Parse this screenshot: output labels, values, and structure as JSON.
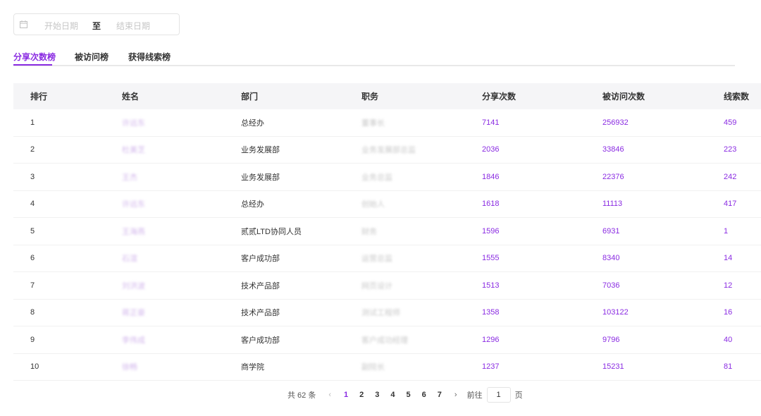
{
  "date_range": {
    "start_placeholder": "开始日期",
    "separator": "至",
    "end_placeholder": "结束日期",
    "icon": "calendar-icon"
  },
  "tabs": [
    {
      "label": "分享次数榜",
      "active": true
    },
    {
      "label": "被访问榜",
      "active": false
    },
    {
      "label": "获得线索榜",
      "active": false
    }
  ],
  "colors": {
    "accent": "#8a2be2",
    "header_bg": "#f5f5f7"
  },
  "table": {
    "headers": [
      "排行",
      "姓名",
      "部门",
      "职务",
      "分享次数",
      "被访问次数",
      "线索数"
    ],
    "rows": [
      {
        "rank": "1",
        "name": "许远东",
        "dept": "总经办",
        "title": "董事长",
        "shares": "7141",
        "visits": "256932",
        "leads": "459"
      },
      {
        "rank": "2",
        "name": "杜美芝",
        "dept": "业务发展部",
        "title": "业务发展部总监",
        "shares": "2036",
        "visits": "33846",
        "leads": "223"
      },
      {
        "rank": "3",
        "name": "王杰",
        "dept": "业务发展部",
        "title": "业务总监",
        "shares": "1846",
        "visits": "22376",
        "leads": "242"
      },
      {
        "rank": "4",
        "name": "许远东",
        "dept": "总经办",
        "title": "创始人",
        "shares": "1618",
        "visits": "11113",
        "leads": "417"
      },
      {
        "rank": "5",
        "name": "王海燕",
        "dept": "贰贰LTD协同人员",
        "title": "财务",
        "shares": "1596",
        "visits": "6931",
        "leads": "1"
      },
      {
        "rank": "6",
        "name": "石渲",
        "dept": "客户成功部",
        "title": "运营总监",
        "shares": "1555",
        "visits": "8340",
        "leads": "14"
      },
      {
        "rank": "7",
        "name": "刘洪波",
        "dept": "技术产品部",
        "title": "网页设计",
        "shares": "1513",
        "visits": "7036",
        "leads": "12"
      },
      {
        "rank": "8",
        "name": "蒋正豪",
        "dept": "技术产品部",
        "title": "测试工程师",
        "shares": "1358",
        "visits": "103122",
        "leads": "16"
      },
      {
        "rank": "9",
        "name": "李伟成",
        "dept": "客户成功部",
        "title": "客户成功经理",
        "shares": "1296",
        "visits": "9796",
        "leads": "40"
      },
      {
        "rank": "10",
        "name": "徐畅",
        "dept": "商学院",
        "title": "副院长",
        "shares": "1237",
        "visits": "15231",
        "leads": "81"
      }
    ]
  },
  "pagination": {
    "total_label": "共 62 条",
    "prev": "‹",
    "next": "›",
    "pages": [
      "1",
      "2",
      "3",
      "4",
      "5",
      "6",
      "7"
    ],
    "current": "1",
    "goto_label": "前往",
    "goto_value": "1",
    "page_unit": "页"
  }
}
